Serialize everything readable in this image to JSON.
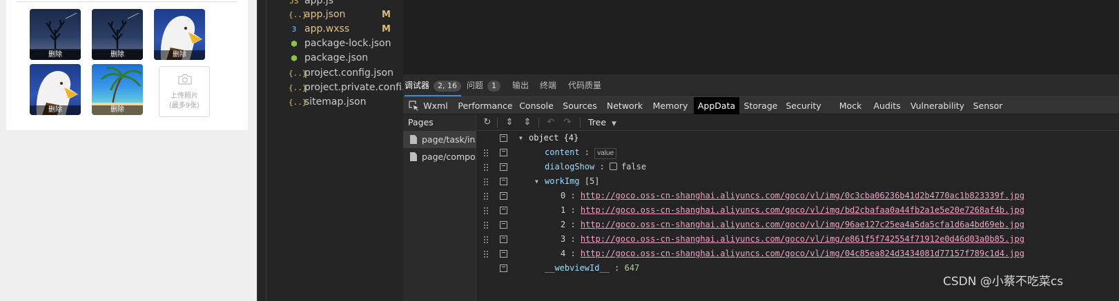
{
  "simulator": {
    "images": [
      {
        "label": "删除",
        "kind": "night"
      },
      {
        "label": "删除",
        "kind": "night"
      },
      {
        "label": "删除",
        "kind": "eagle"
      },
      {
        "label": "删除",
        "kind": "eagle"
      },
      {
        "label": "删除",
        "kind": "beach"
      }
    ],
    "upload": {
      "line1": "上传照片",
      "line2": "(最多9张)"
    }
  },
  "file_tree": {
    "files": [
      {
        "name": "app.js",
        "icon": "js-file-icon",
        "status": ""
      },
      {
        "name": "app.json",
        "icon": "json-file-icon",
        "status": "M"
      },
      {
        "name": "app.wxss",
        "icon": "css-file-icon",
        "status": "M"
      },
      {
        "name": "package-lock.json",
        "icon": "package-file-icon",
        "status": ""
      },
      {
        "name": "package.json",
        "icon": "package-file-icon",
        "status": ""
      },
      {
        "name": "project.config.json",
        "icon": "json-file-icon",
        "status": ""
      },
      {
        "name": "project.private.confi...",
        "icon": "json-file-icon",
        "status": ""
      },
      {
        "name": "sitemap.json",
        "icon": "json-file-icon",
        "status": ""
      }
    ]
  },
  "devtools": {
    "top_tabs": [
      {
        "label": "调试器",
        "badge": "2, 16"
      },
      {
        "label": "问题",
        "badge": "1"
      },
      {
        "label": "输出",
        "badge": ""
      },
      {
        "label": "终端",
        "badge": ""
      },
      {
        "label": "代码质量",
        "badge": ""
      }
    ],
    "panel_tabs": [
      "Wxml",
      "Performance",
      "Console",
      "Sources",
      "Network",
      "Memory",
      "AppData",
      "Storage",
      "Security",
      "Mock",
      "Audits",
      "Vulnerability",
      "Sensor"
    ],
    "active_panel": "AppData",
    "pages_title": "Pages",
    "pages": [
      "page/task/in...",
      "page/compo..."
    ],
    "view_mode": "Tree",
    "tree": {
      "root": "object {4}",
      "content_key": "content",
      "content_value": "value",
      "dialog_key": "dialogShow",
      "dialog_value": "false",
      "workimg_key": "workImg",
      "workimg_count": "[5]",
      "work_images": [
        {
          "index": "0",
          "url": "http://goco.oss-cn-shanghai.aliyuncs.com/goco/vl/img/0c3cba06236b41d2b4770ac1b823339f.jpg"
        },
        {
          "index": "1",
          "url": "http://goco.oss-cn-shanghai.aliyuncs.com/goco/vl/img/bd2cbafaa0a44fb2a1e5e20e7268af4b.jpg"
        },
        {
          "index": "2",
          "url": "http://goco.oss-cn-shanghai.aliyuncs.com/goco/vl/img/96ae127c25ea4a5da5cfa1d6a4bd69eb.jpg"
        },
        {
          "index": "3",
          "url": "http://goco.oss-cn-shanghai.aliyuncs.com/goco/vl/img/e861f5f742554f71912e0d46d03a0b85.jpg"
        },
        {
          "index": "4",
          "url": "http://goco.oss-cn-shanghai.aliyuncs.com/goco/vl/img/04c85ea824d3434081d77157f789c1d4.jpg"
        }
      ],
      "webview_key": "__webviewId__",
      "webview_value": "647"
    }
  },
  "watermark": "CSDN @小蔡不吃菜cs"
}
